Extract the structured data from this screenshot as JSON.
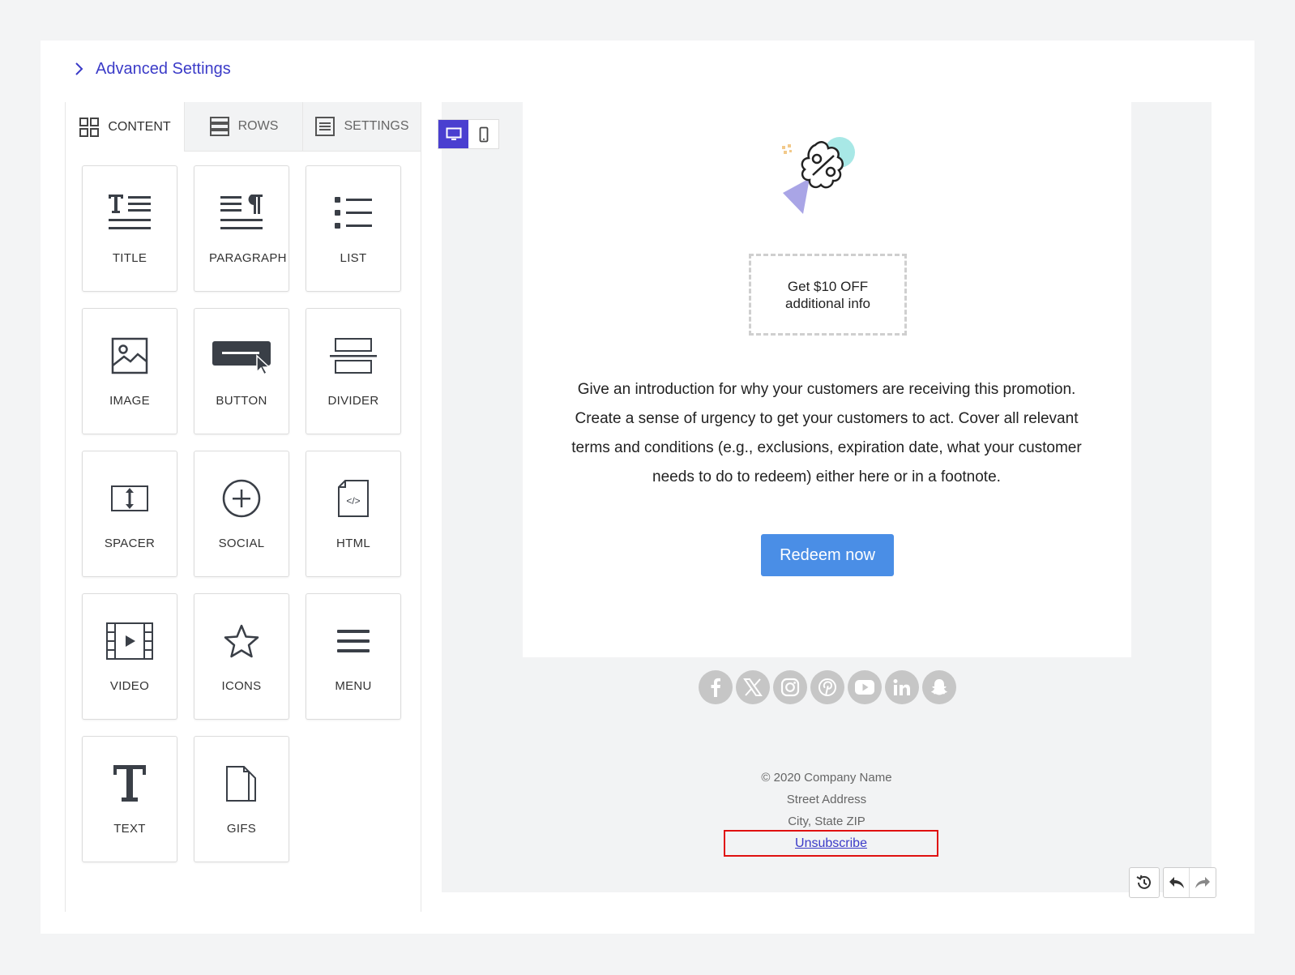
{
  "advanced_settings": {
    "label": "Advanced Settings"
  },
  "tabs": [
    {
      "label": "CONTENT",
      "icon": "grid-icon",
      "active": true
    },
    {
      "label": "ROWS",
      "icon": "rows-icon",
      "active": false
    },
    {
      "label": "SETTINGS",
      "icon": "settings-icon",
      "active": false
    }
  ],
  "blocks": [
    {
      "label": "TITLE",
      "icon": "title-icon"
    },
    {
      "label": "PARAGRAPH",
      "icon": "paragraph-icon"
    },
    {
      "label": "LIST",
      "icon": "list-icon"
    },
    {
      "label": "IMAGE",
      "icon": "image-icon"
    },
    {
      "label": "BUTTON",
      "icon": "button-icon"
    },
    {
      "label": "DIVIDER",
      "icon": "divider-icon"
    },
    {
      "label": "SPACER",
      "icon": "spacer-icon"
    },
    {
      "label": "SOCIAL",
      "icon": "social-icon"
    },
    {
      "label": "HTML",
      "icon": "html-icon"
    },
    {
      "label": "VIDEO",
      "icon": "video-icon"
    },
    {
      "label": "ICONS",
      "icon": "star-icon"
    },
    {
      "label": "MENU",
      "icon": "menu-icon"
    },
    {
      "label": "TEXT",
      "icon": "text-icon"
    },
    {
      "label": "GIFS",
      "icon": "gif-file-icon"
    }
  ],
  "device_switch": {
    "desktop_icon": "desktop-icon",
    "mobile_icon": "mobile-icon",
    "active": "desktop"
  },
  "email": {
    "coupon_line1": "Get $10 OFF",
    "coupon_line2": "additional info",
    "intro": "Give an introduction for why your customers are receiving this promotion. Create a sense of urgency to get your customers to act. Cover all relevant terms and conditions (e.g., exclusions, expiration date, what your customer needs to do to redeem) either here or in a footnote.",
    "redeem_label": "Redeem now",
    "social_icons": [
      "facebook-icon",
      "x-icon",
      "instagram-icon",
      "pinterest-icon",
      "youtube-icon",
      "linkedin-icon",
      "snapchat-icon"
    ],
    "footer": {
      "copyright": "© 2020 Company Name",
      "street": "Street Address",
      "city": "City, State ZIP",
      "unsubscribe": "Unsubscribe"
    }
  },
  "colors": {
    "accent": "#4a3fd0",
    "button": "#4a8ee6",
    "link": "#3b3bc8",
    "highlight": "#e01010"
  },
  "history_icons": [
    "history-icon",
    "undo-icon",
    "redo-icon"
  ]
}
